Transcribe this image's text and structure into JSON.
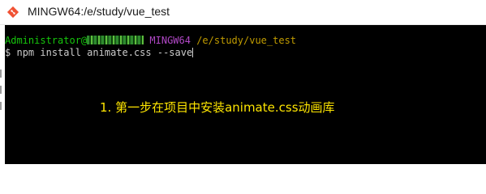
{
  "window": {
    "title": "MINGW64:/e/study/vue_test"
  },
  "terminal": {
    "user": "Administrator@",
    "env": "MINGW64",
    "path": "/e/study/vue_test",
    "prompt": "$",
    "command": "npm install animate.css --save"
  },
  "annotation": {
    "text": "1. 第一步在项目中安装animate.css动画库"
  },
  "colors": {
    "terminal_bg": "#000000",
    "user_green": "#16c60c",
    "env_magenta": "#b148c6",
    "path_yellow": "#c19c00",
    "annotation_yellow": "#ffe600"
  }
}
